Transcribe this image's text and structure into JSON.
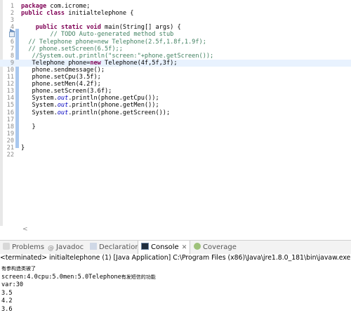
{
  "editor": {
    "lines": [
      {
        "n": "1",
        "html_parts": [
          {
            "t": "kw",
            "v": "package"
          },
          {
            "t": "",
            "v": " com.icrome;"
          }
        ]
      },
      {
        "n": "2",
        "html_parts": [
          {
            "t": "kw",
            "v": "public"
          },
          {
            "t": "",
            "v": " "
          },
          {
            "t": "kw",
            "v": "class"
          },
          {
            "t": "",
            "v": " initialtelephone {"
          }
        ]
      },
      {
        "n": "3",
        "html_parts": []
      },
      {
        "n": "4",
        "html_parts": [
          {
            "t": "",
            "v": "    "
          },
          {
            "t": "kw",
            "v": "public"
          },
          {
            "t": "",
            "v": " "
          },
          {
            "t": "kw",
            "v": "static"
          },
          {
            "t": "",
            "v": " "
          },
          {
            "t": "kw",
            "v": "void"
          },
          {
            "t": "",
            "v": " main(String[] args) {"
          }
        ]
      },
      {
        "n": "5",
        "html_parts": [
          {
            "t": "cm",
            "v": "        // TODO Auto-generated method stub"
          }
        ]
      },
      {
        "n": "6",
        "html_parts": [
          {
            "t": "cm",
            "v": "  // Telephone phone=new Telephone(2.5f,1.8f,1.9f);"
          }
        ]
      },
      {
        "n": "7",
        "html_parts": [
          {
            "t": "cm",
            "v": "  // phone.setScreen(6.5f);;"
          }
        ]
      },
      {
        "n": "8",
        "html_parts": [
          {
            "t": "cm",
            "v": "   //System.out.println(\"screen:\"+phone.getScreen());"
          }
        ]
      },
      {
        "n": "9",
        "html_parts": [
          {
            "t": "",
            "v": "   Telephone phone="
          },
          {
            "t": "kw",
            "v": "new"
          },
          {
            "t": "",
            "v": " Telephone(4f,5f,3f);"
          }
        ]
      },
      {
        "n": "10",
        "html_parts": [
          {
            "t": "",
            "v": "   phone.sendmessage();"
          }
        ]
      },
      {
        "n": "11",
        "html_parts": [
          {
            "t": "",
            "v": "   phone.setCpu(3.5f);"
          }
        ]
      },
      {
        "n": "12",
        "html_parts": [
          {
            "t": "",
            "v": "   phone.setMen(4.2f);"
          }
        ]
      },
      {
        "n": "13",
        "html_parts": [
          {
            "t": "",
            "v": "   phone.setScreen(3.6f);"
          }
        ]
      },
      {
        "n": "14",
        "html_parts": [
          {
            "t": "",
            "v": "   System."
          },
          {
            "t": "fld",
            "v": "out"
          },
          {
            "t": "",
            "v": ".println(phone.getCpu());"
          }
        ]
      },
      {
        "n": "15",
        "html_parts": [
          {
            "t": "",
            "v": "   System."
          },
          {
            "t": "fld",
            "v": "out"
          },
          {
            "t": "",
            "v": ".println(phone.getMen());"
          }
        ]
      },
      {
        "n": "16",
        "html_parts": [
          {
            "t": "",
            "v": "   System."
          },
          {
            "t": "fld",
            "v": "out"
          },
          {
            "t": "",
            "v": ".println(phone.getScreen());"
          }
        ]
      },
      {
        "n": "17",
        "html_parts": []
      },
      {
        "n": "18",
        "html_parts": [
          {
            "t": "",
            "v": "   }"
          }
        ]
      },
      {
        "n": "19",
        "html_parts": []
      },
      {
        "n": "20",
        "html_parts": []
      },
      {
        "n": "21",
        "html_parts": [
          {
            "t": "",
            "v": "}"
          }
        ]
      },
      {
        "n": "22",
        "html_parts": []
      }
    ],
    "highlighted_line": "9"
  },
  "views": {
    "tabs": [
      {
        "label": "Problems",
        "icon": "problems-icon"
      },
      {
        "label": "Javadoc",
        "icon": "javadoc-icon"
      },
      {
        "label": "Declaration",
        "icon": "declaration-icon"
      },
      {
        "label": "Console",
        "icon": "console-icon",
        "active": true
      },
      {
        "label": "Coverage",
        "icon": "coverage-icon"
      }
    ],
    "close_label": "✕"
  },
  "console": {
    "header": "<terminated> initialtelephone (1) [Java Application] C:\\Program Files (x86)\\Java\\jre1.8.0_181\\bin\\javaw.exe (2018",
    "line1": "有参构造类被了",
    "line2_prefix": "screen:4.0cpu:5.0men:5.0Telephone",
    "line2_suffix": "有发短信的功能",
    "line3": "var:30",
    "line4": "3.5",
    "line5": "4.2",
    "line6": "3.6"
  },
  "colors": {
    "keyword": "#7f0055",
    "comment": "#3f7f5f",
    "field": "#0000c0",
    "highlight": "#e8f2fe"
  }
}
